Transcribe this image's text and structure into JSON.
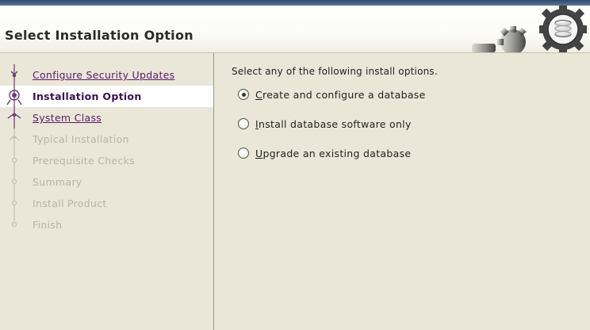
{
  "header": {
    "title": "Select Installation Option"
  },
  "steps": [
    {
      "label": "Configure Security Updates",
      "state": "done"
    },
    {
      "label": "Installation Option",
      "state": "current"
    },
    {
      "label": "System Class",
      "state": "done"
    },
    {
      "label": "Typical Installation",
      "state": "pending"
    },
    {
      "label": "Prerequisite Checks",
      "state": "pending"
    },
    {
      "label": "Summary",
      "state": "pending"
    },
    {
      "label": "Install Product",
      "state": "pending"
    },
    {
      "label": "Finish",
      "state": "pending"
    }
  ],
  "main": {
    "prompt": "Select any of the following install options.",
    "options": [
      {
        "mnemonic": "C",
        "rest": "reate and configure a database",
        "selected": true
      },
      {
        "mnemonic": "I",
        "rest": "nstall database software only",
        "selected": false
      },
      {
        "mnemonic": "U",
        "rest": "pgrade an existing database",
        "selected": false
      }
    ]
  },
  "colors": {
    "panel_bg": "#eae7d8",
    "link_purple": "#5a1a6b",
    "current_purple": "#3a0f55",
    "disabled_text": "#b7b4a6"
  }
}
